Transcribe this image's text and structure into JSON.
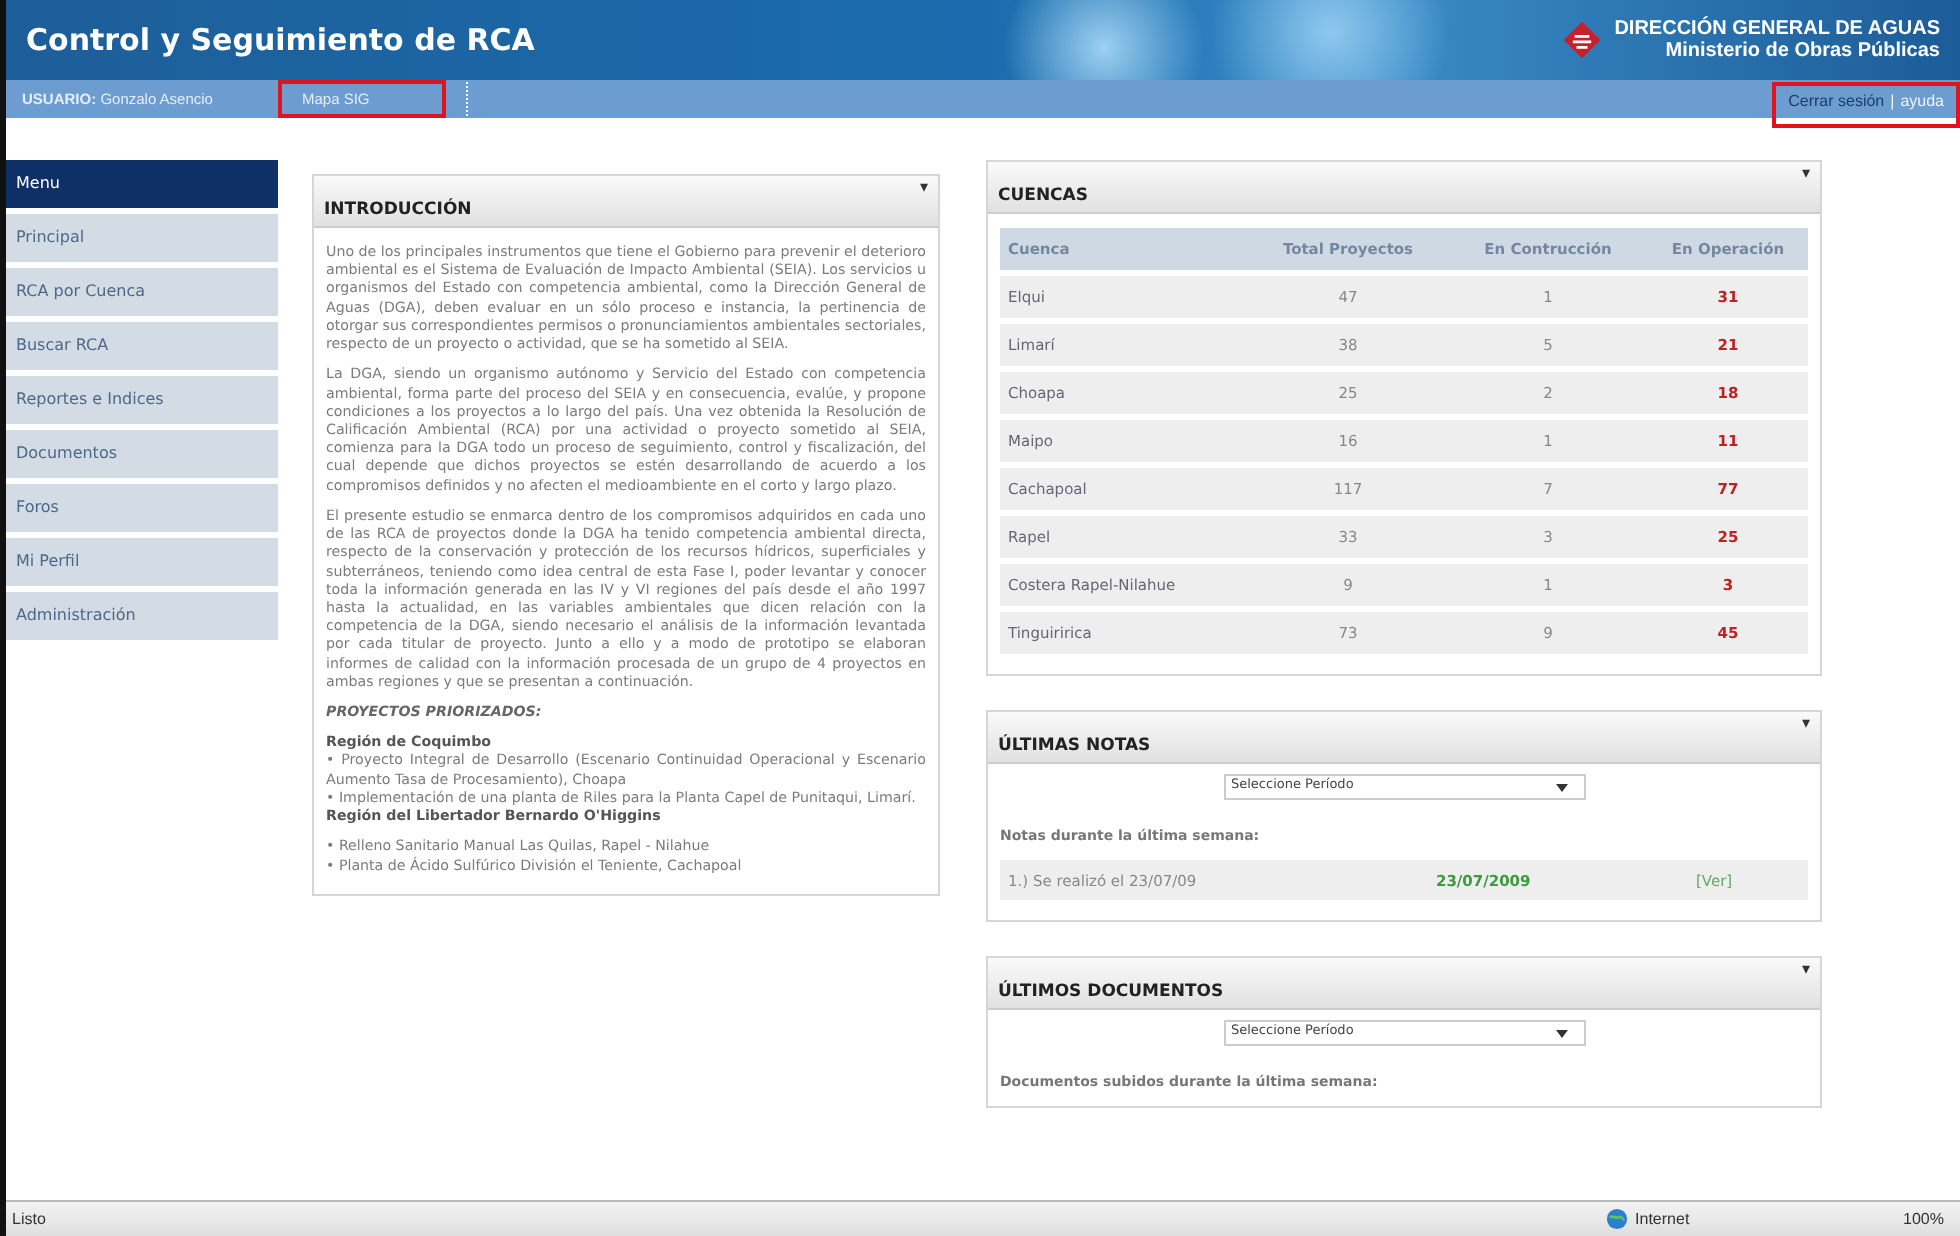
{
  "header": {
    "title": "Control y Seguimiento de RCA",
    "org_name": "DIRECCIÓN GENERAL DE AGUAS",
    "org_subtitle": "Ministerio de Obras Públicas"
  },
  "nav_bar": {
    "user_label": "USUARIO:",
    "user_name": "Gonzalo Asencio",
    "links": [
      {
        "label": "Mapa SIG",
        "highlighted": true
      }
    ],
    "logout": "Cerrar sesión",
    "separator": "|",
    "help": "ayuda",
    "right_highlighted": true
  },
  "sidebar": {
    "items": [
      {
        "label": "Menu",
        "selected": true
      },
      {
        "label": "Principal",
        "selected": false
      },
      {
        "label": "RCA por Cuenca",
        "selected": false
      },
      {
        "label": "Buscar RCA",
        "selected": false
      },
      {
        "label": "Reportes e Indices",
        "selected": false
      },
      {
        "label": "Documentos",
        "selected": false
      },
      {
        "label": "Foros",
        "selected": false
      },
      {
        "label": "Mi Perfil",
        "selected": false
      },
      {
        "label": "Administración",
        "selected": false
      }
    ]
  },
  "intro": {
    "title": "INTRODUCCIÓN",
    "collapse": "▾",
    "paragraphs": [
      "Uno de los principales instrumentos que tiene el Gobierno para prevenir el deterioro ambiental es el Sistema de Evaluación de Impacto Ambiental (SEIA). Los servicios u organismos del Estado con competencia ambiental, como la Dirección General de Aguas (DGA), deben evaluar en un sólo proceso e instancia, la pertinencia de otorgar sus correspondientes permisos o pronunciamientos ambientales sectoriales, respecto de un proyecto o actividad, que se ha sometido al SEIA.",
      "La DGA, siendo un organismo autónomo y Servicio del Estado con competencia ambiental, forma parte del proceso del SEIA y en consecuencia, evalúe, y propone condiciones a los proyectos a lo largo del país. Una vez obtenida la Resolución de Calificación Ambiental (RCA) por una actividad o proyecto sometido al SEIA, comienza para la DGA todo un proceso de seguimiento, control y fiscalización, del cual depende que dichos proyectos se estén desarrollando de acuerdo a los compromisos definidos y no afecten el medioambiente en el corto y largo plazo.",
      "El presente estudio se enmarca dentro de los compromisos adquiridos en cada uno de las RCA de proyectos donde la DGA ha tenido competencia ambiental directa, respecto de la conservación y protección de los recursos hídricos, superficiales y subterráneos, teniendo como idea central de esta Fase I, poder levantar y conocer toda la información generada en las IV y VI regiones del país desde el año 1997 hasta la actualidad, en las variables ambientales que dicen relación con la competencia de la DGA, siendo necesario el análisis de la información levantada por cada titular de proyecto. Junto a ello y a modo de prototipo se elaboran informes de calidad con la información procesada de un grupo de 4 proyectos en ambas regiones y que se presentan a continuación."
    ],
    "projects_heading": "PROYECTOS PRIORIZADOS:",
    "regions": [
      {
        "name": "Región de Coquimbo",
        "projects": [
          "• Proyecto Integral de Desarrollo (Escenario Continuidad Operacional y Escenario Aumento Tasa de Procesamiento), Choapa",
          "• Implementación de una planta de Riles para la Planta Capel de Punitaqui, Limarí."
        ]
      },
      {
        "name": "Región del Libertador Bernardo O'Higgins",
        "projects": [
          "• Relleno Sanitario Manual Las Quilas, Rapel - Nilahue",
          "• Planta de Ácido Sulfúrico División el Teniente, Cachapoal"
        ]
      }
    ]
  },
  "cuencas": {
    "title": "CUENCAS",
    "collapse": "▾",
    "columns": [
      "Cuenca",
      "Total Proyectos",
      "En Contrucción",
      "En Operación"
    ],
    "rows": [
      [
        "Elqui",
        "47",
        "1",
        "31"
      ],
      [
        "Limarí",
        "38",
        "5",
        "21"
      ],
      [
        "Choapa",
        "25",
        "2",
        "18"
      ],
      [
        "Maipo",
        "16",
        "1",
        "11"
      ],
      [
        "Cachapoal",
        "117",
        "7",
        "77"
      ],
      [
        "Rapel",
        "33",
        "3",
        "25"
      ],
      [
        "Costera Rapel-Nilahue",
        "9",
        "1",
        "3"
      ],
      [
        "Tinguiririca",
        "73",
        "9",
        "45"
      ]
    ]
  },
  "notas": {
    "title": "ÚLTIMAS NOTAS",
    "collapse": "▾",
    "period_select": "Seleccione Período",
    "caption": "Notas durante la última semana:",
    "items": [
      {
        "text": "1.) Se realizó el 23/07/09",
        "date": "23/07/2009",
        "link": "[Ver]"
      }
    ]
  },
  "documentos": {
    "title": "ÚLTIMOS DOCUMENTOS",
    "collapse": "▾",
    "period_select": "Seleccione Período",
    "caption": "Documentos subidos durante la última semana:"
  },
  "status_bar": {
    "status": "Listo",
    "zone": "Internet",
    "zoom": "100%"
  }
}
